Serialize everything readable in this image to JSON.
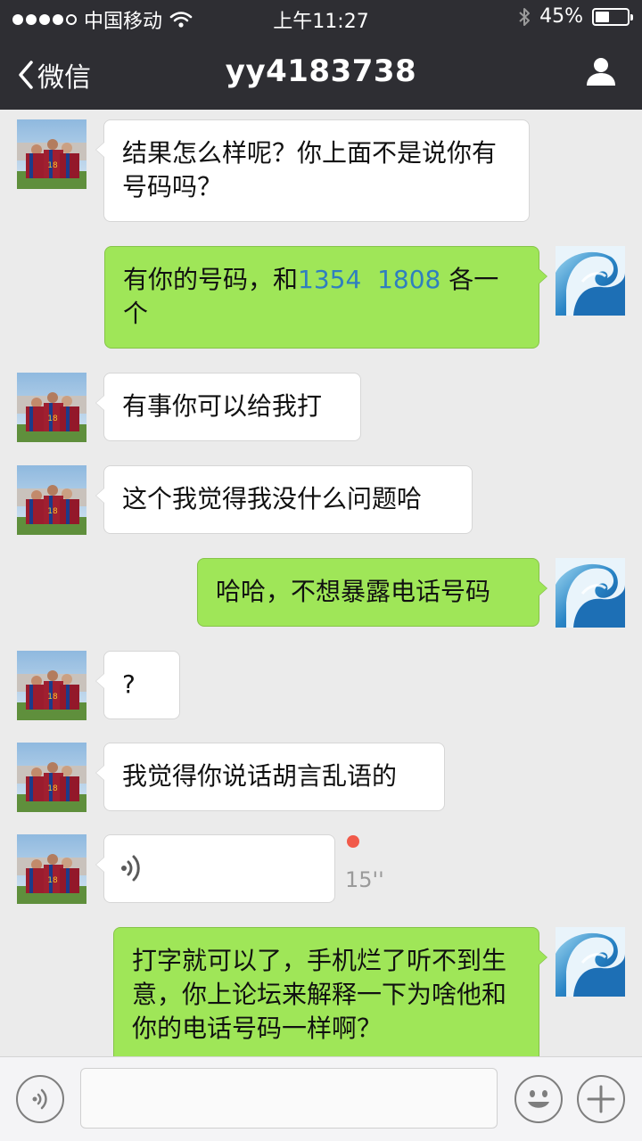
{
  "status_bar": {
    "carrier": "中国移动",
    "time": "上午11:27",
    "battery_percent_text": "45%",
    "battery_level": 0.45,
    "signal_bars_filled": 4,
    "signal_bars_total": 5
  },
  "nav": {
    "back_label": "微信",
    "title": "yy4183738"
  },
  "messages": [
    {
      "side": "received",
      "type": "text",
      "text": "结果怎么样呢？你上面不是说你有号码吗？"
    },
    {
      "side": "sent",
      "type": "text",
      "text_before": "有你的号码，和",
      "link": "1354  1808",
      "text_after": " 各一个"
    },
    {
      "side": "received",
      "type": "text",
      "text": "有事你可以给我打"
    },
    {
      "side": "received",
      "type": "text",
      "text": "这个我觉得我没什么问题哈"
    },
    {
      "side": "sent",
      "type": "text",
      "text": "哈哈，不想暴露电话号码"
    },
    {
      "side": "received",
      "type": "text",
      "text": "?"
    },
    {
      "side": "received",
      "type": "text",
      "text": "我觉得你说话胡言乱语的"
    },
    {
      "side": "received",
      "type": "voice",
      "duration": "15''",
      "unread": true
    },
    {
      "side": "sent",
      "type": "text",
      "text": "打字就可以了，手机烂了听不到生意，你上论坛来解释一下为啥他和你的电话号码一样啊？"
    }
  ],
  "icons": {
    "back": "chevron-left-icon",
    "profile": "person-icon",
    "voice_mode": "voice-icon",
    "emoji": "smiley-icon",
    "more": "plus-icon"
  },
  "colors": {
    "header_bg": "#2e2e33",
    "chat_bg": "#ebebeb",
    "sent_bubble": "#9fe658",
    "received_bubble": "#ffffff",
    "link": "#2f7fbf",
    "unread_dot": "#f15a4a"
  }
}
